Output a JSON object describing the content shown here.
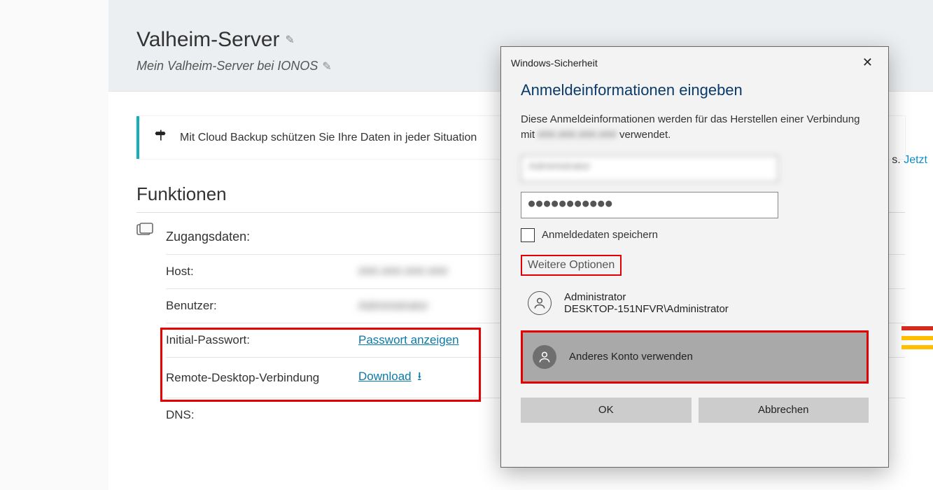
{
  "header": {
    "title": "Valheim-Server",
    "subtitle": "Mein Valheim-Server bei IONOS"
  },
  "alert": {
    "text": "Mit Cloud Backup schützen Sie Ihre Daten in jeder Situation",
    "link_suffix_s": "s.",
    "link_jetzt": "Jetzt"
  },
  "section": {
    "title": "Funktionen",
    "access_label": "Zugangsdaten:",
    "rows": {
      "host_k": "Host:",
      "host_v": "###.###.###.###",
      "user_k": "Benutzer:",
      "user_v": "Administrator",
      "pass_k": "Initial-Passwort:",
      "pass_link": "Passwort anzeigen",
      "rdp_k": "Remote-Desktop-Verbindung",
      "rdp_link": "Download",
      "dns_k": "DNS:"
    }
  },
  "dialog": {
    "window_title": "Windows-Sicherheit",
    "heading": "Anmeldeinformationen eingeben",
    "desc_a": "Diese Anmeldeinformationen werden für das Herstellen einer Verbindung mit ",
    "desc_host": "###.###.###.###",
    "desc_b": " verwendet.",
    "user_value": "Administrator",
    "pass_value": "●●●●●●●●●●●",
    "remember": "Anmeldedaten speichern",
    "more": "Weitere Optionen",
    "acct1_name": "Administrator",
    "acct1_path": "DESKTOP-151NFVR\\Administrator",
    "acct2_label": "Anderes Konto verwenden",
    "ok": "OK",
    "cancel": "Abbrechen"
  }
}
